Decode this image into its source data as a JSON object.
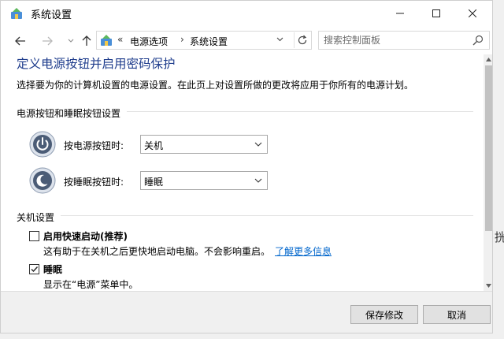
{
  "window": {
    "title": "系统设置"
  },
  "titlebar_controls": {
    "minimize_icon": "minimize-icon",
    "maximize_icon": "maximize-icon",
    "close_icon": "close-icon"
  },
  "address": {
    "separator": "«",
    "breadcrumbs": [
      "电源选项",
      "系统设置"
    ],
    "crumb_separator": "›"
  },
  "search": {
    "placeholder": "搜索控制面板"
  },
  "page": {
    "title": "定义电源按钮并启用密码保护",
    "description": "选择要为你的计算机设置的电源设置。在此页上对设置所做的更改将应用于你所有的电源计划。"
  },
  "buttons_section": {
    "heading": "电源按钮和睡眠按钮设置",
    "power": {
      "label": "按电源按钮时:",
      "value": "关机"
    },
    "sleep": {
      "label": "按睡眠按钮时:",
      "value": "睡眠"
    }
  },
  "shutdown_section": {
    "heading": "关机设置",
    "fast_startup": {
      "label": "启用快速启动(推荐)",
      "checked": false,
      "description": "这有助于在关机之后更快地启动电脑。不会影响重启。",
      "link": "了解更多信息"
    },
    "sleep": {
      "label": "睡眠",
      "checked": true,
      "description": "显示在“电源”菜单中。"
    }
  },
  "footer": {
    "save_label": "保存修改",
    "cancel_label": "取消"
  },
  "background_fragment": "挄",
  "colors": {
    "title_blue": "#1e3c8c",
    "link_blue": "#0066cc"
  }
}
